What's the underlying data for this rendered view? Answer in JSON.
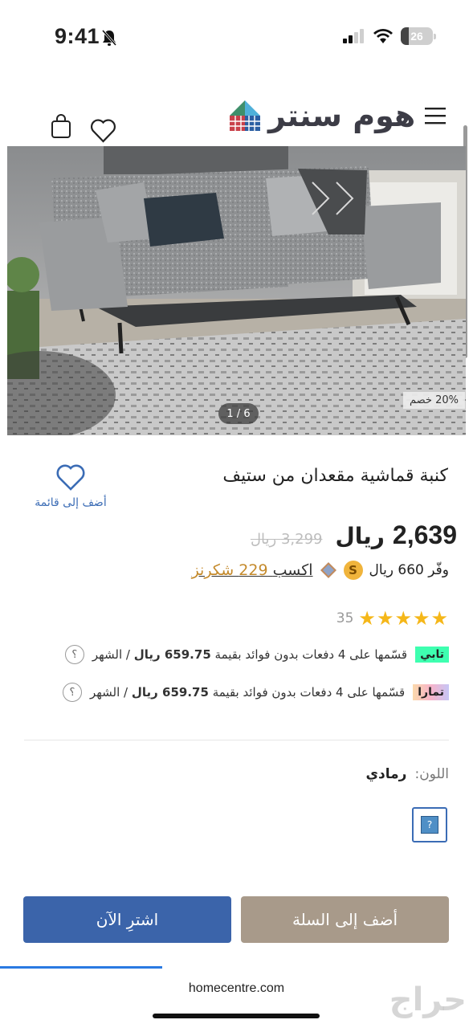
{
  "status_bar": {
    "time": "9:41",
    "battery": "26",
    "battery_level": 0.26
  },
  "header": {
    "logo_text": "هوم سنتر"
  },
  "hero": {
    "discount_badge": "20% خصم",
    "pager": "1 / 6"
  },
  "product": {
    "title": "كنبة قماشية مقعدان من ستيف",
    "wishlist_label": "أضف إلى قائمة",
    "price_now": "2,639",
    "currency": "ريال",
    "price_old": "3,299 ريال",
    "save_text": "وفّر 660  ريال",
    "earn_text": "اكسب",
    "earn_points": "229 شكرنز",
    "rating_stars": "★★★★★",
    "rating_value": 5,
    "rating_count": "35"
  },
  "installments": {
    "tabby": {
      "logo": "تابي",
      "text_pre": "قسّمها على 4 دفعات بدون فوائد بقيمة",
      "amount": "659.75 ريال",
      "text_post": "/ الشهر",
      "help": "؟"
    },
    "tamara": {
      "logo": "تمارا",
      "text_pre": "قسّمها على 4 دفعات بدون فوائد بقيمة",
      "amount": "659.75 ريال",
      "text_post": "/ الشهر",
      "help": "؟"
    }
  },
  "color": {
    "label": "اللون:",
    "value": "رمادي",
    "swatch_glyph": "?"
  },
  "buttons": {
    "add_to_cart": "أضف إلى السلة",
    "buy_now": "اشترِ الآن"
  },
  "browser": {
    "url": "homecentre.com",
    "watermark": "حراج"
  },
  "colors": {
    "primary_blue": "#3b64aa",
    "cart_taupe": "#a89a8a",
    "star": "#f5b719",
    "tabby": "#3effb0"
  },
  "icons": [
    "signal-icon",
    "wifi-icon",
    "bell-off-icon",
    "menu-icon",
    "heart-icon",
    "cart-icon",
    "logo-icon",
    "s-coin-icon"
  ]
}
